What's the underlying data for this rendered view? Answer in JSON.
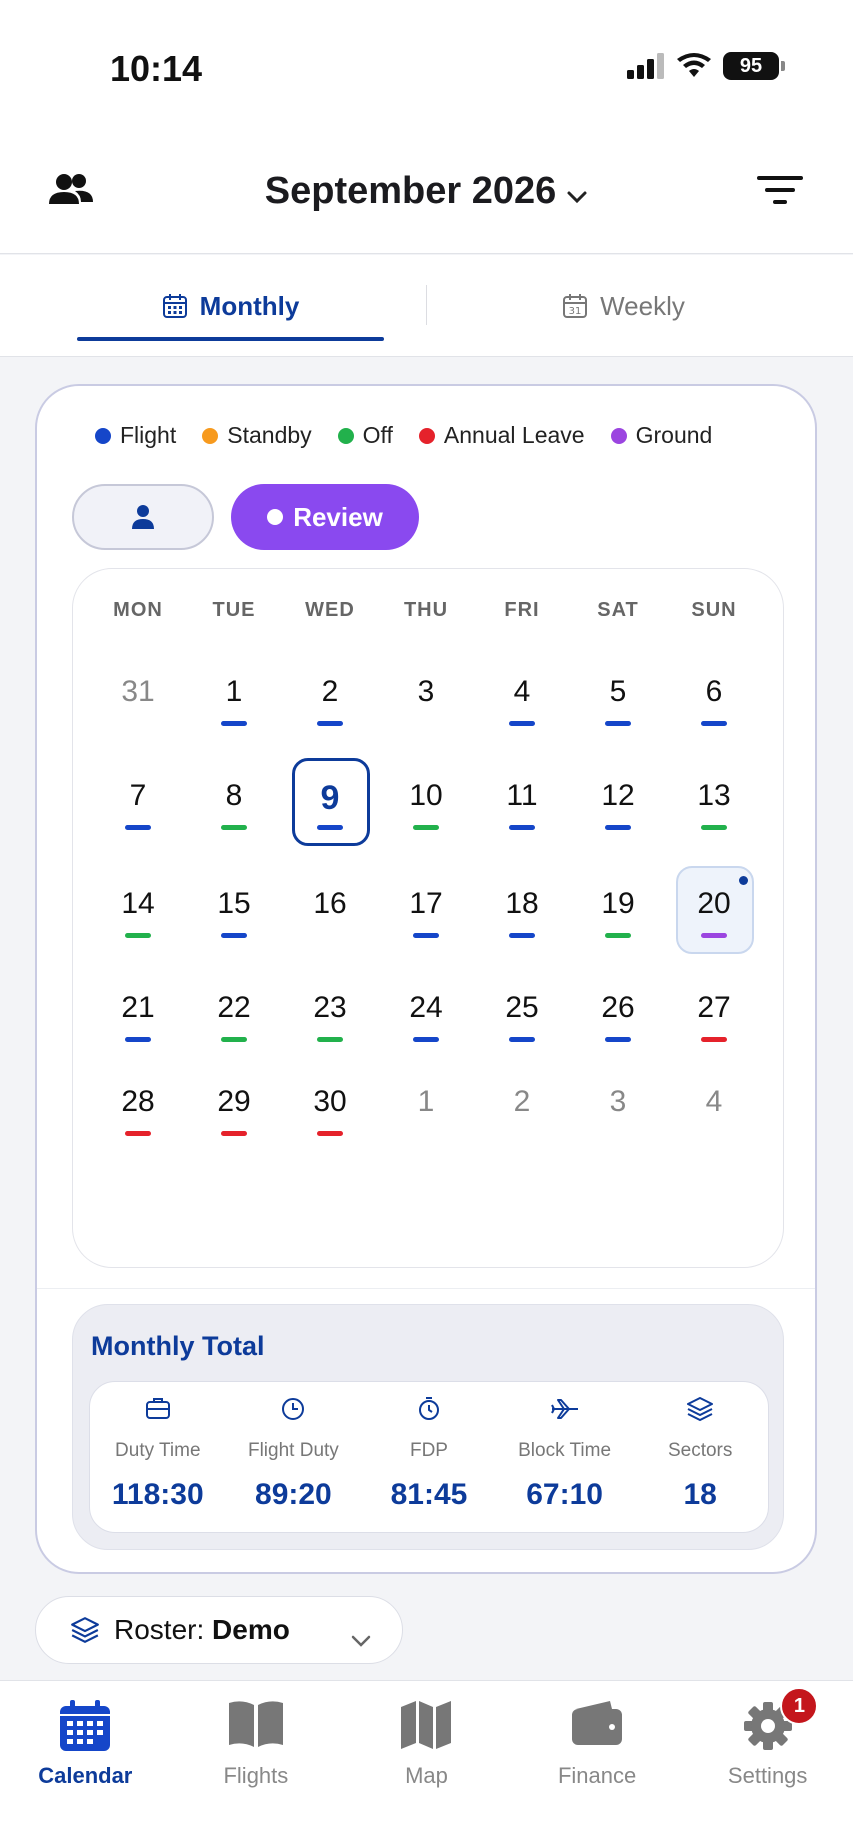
{
  "status": {
    "time": "10:14",
    "battery": "95"
  },
  "header": {
    "title": "September 2026"
  },
  "tabs": [
    {
      "label": "Monthly"
    },
    {
      "label": "Weekly"
    }
  ],
  "legend": [
    {
      "label": "Flight",
      "color": "#1546c9"
    },
    {
      "label": "Standby",
      "color": "#f79a1e"
    },
    {
      "label": "Off",
      "color": "#22b14c"
    },
    {
      "label": "Annual Leave",
      "color": "#e5222b"
    },
    {
      "label": "Ground",
      "color": "#9b45e0"
    }
  ],
  "review_button": {
    "label": "Review"
  },
  "calendar": {
    "weekdays": [
      "MON",
      "TUE",
      "WED",
      "THU",
      "FRI",
      "SAT",
      "SUN"
    ],
    "weeks": [
      [
        {
          "d": "31",
          "m": true
        },
        {
          "d": "1",
          "c": "flight"
        },
        {
          "d": "2",
          "c": "flight"
        },
        {
          "d": "3"
        },
        {
          "d": "4",
          "c": "flight"
        },
        {
          "d": "5",
          "c": "flight"
        },
        {
          "d": "6",
          "c": "flight"
        }
      ],
      [
        {
          "d": "7",
          "c": "flight"
        },
        {
          "d": "8",
          "c": "off"
        },
        {
          "d": "9",
          "c": "flight",
          "today": true
        },
        {
          "d": "10",
          "c": "off"
        },
        {
          "d": "11",
          "c": "flight"
        },
        {
          "d": "12",
          "c": "flight"
        },
        {
          "d": "13",
          "c": "off"
        }
      ],
      [
        {
          "d": "14",
          "c": "off"
        },
        {
          "d": "15",
          "c": "flight"
        },
        {
          "d": "16"
        },
        {
          "d": "17",
          "c": "flight"
        },
        {
          "d": "18",
          "c": "flight"
        },
        {
          "d": "19",
          "c": "off"
        },
        {
          "d": "20",
          "c": "ground",
          "selected": true
        }
      ],
      [
        {
          "d": "21",
          "c": "flight"
        },
        {
          "d": "22",
          "c": "off"
        },
        {
          "d": "23",
          "c": "off"
        },
        {
          "d": "24",
          "c": "flight"
        },
        {
          "d": "25",
          "c": "flight"
        },
        {
          "d": "26",
          "c": "flight"
        },
        {
          "d": "27",
          "c": "leave"
        }
      ],
      [
        {
          "d": "28",
          "c": "leave"
        },
        {
          "d": "29",
          "c": "leave"
        },
        {
          "d": "30",
          "c": "leave"
        },
        {
          "d": "1",
          "m": true
        },
        {
          "d": "2",
          "m": true
        },
        {
          "d": "3",
          "m": true
        },
        {
          "d": "4",
          "m": true
        }
      ]
    ],
    "category_colors": {
      "flight": "#1546c9",
      "off": "#22b14c",
      "leave": "#e5222b",
      "ground": "#9b45e0",
      "standby": "#f79a1e"
    }
  },
  "totals": {
    "title": "Monthly Total",
    "metrics": [
      {
        "label": "Duty Time",
        "value": "118:30",
        "icon": "briefcase-icon"
      },
      {
        "label": "Flight Duty",
        "value": "89:20",
        "icon": "clock-icon"
      },
      {
        "label": "FDP",
        "value": "81:45",
        "icon": "timer-icon"
      },
      {
        "label": "Block Time",
        "value": "67:10",
        "icon": "airplane-icon"
      },
      {
        "label": "Sectors",
        "value": "18",
        "icon": "layers-icon"
      }
    ]
  },
  "roster": {
    "prefix": "Roster:",
    "name": "Demo"
  },
  "tabbar": [
    {
      "label": "Calendar",
      "icon": "calendar-icon"
    },
    {
      "label": "Flights",
      "icon": "book-icon"
    },
    {
      "label": "Map",
      "icon": "map-icon"
    },
    {
      "label": "Finance",
      "icon": "wallet-icon"
    },
    {
      "label": "Settings",
      "icon": "gear-icon",
      "badge": "1"
    }
  ]
}
